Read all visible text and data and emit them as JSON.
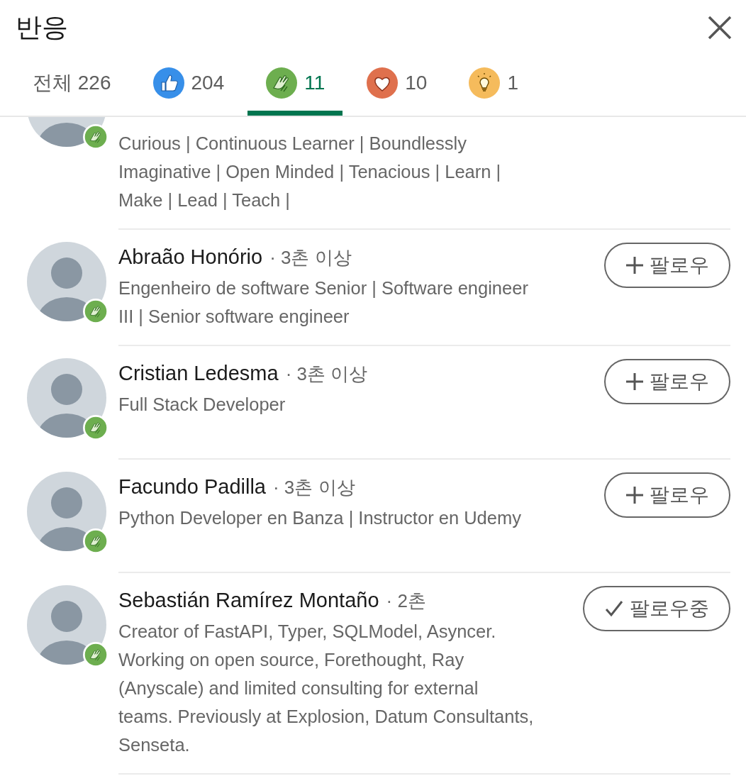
{
  "header": {
    "title": "반응"
  },
  "tabs": [
    {
      "kind": "all",
      "label": "전체 226",
      "selected": false
    },
    {
      "kind": "like",
      "label": "204",
      "selected": false
    },
    {
      "kind": "celebrate",
      "label": "11",
      "selected": true
    },
    {
      "kind": "love",
      "label": "10",
      "selected": false
    },
    {
      "kind": "insightful",
      "label": "1",
      "selected": false
    }
  ],
  "people": [
    {
      "description": "Curious | Continuous Learner | Boundlessly Imaginative | Open Minded | Tenacious | Learn | Make | Lead | Teach |"
    },
    {
      "name": "Abraão Honório",
      "degree": "· 3촌 이상",
      "description": "Engenheiro de software Senior | Software engineer III | Senior software engineer",
      "button": {
        "label": "팔로우",
        "following": false
      }
    },
    {
      "name": "Cristian Ledesma",
      "degree": "· 3촌 이상",
      "description": "Full Stack Developer",
      "button": {
        "label": "팔로우",
        "following": false
      }
    },
    {
      "name": "Facundo Padilla",
      "degree": "· 3촌 이상",
      "description": "Python Developer en Banza | Instructor en Udemy",
      "button": {
        "label": "팔로우",
        "following": false
      }
    },
    {
      "name": "Sebastián Ramírez Montaño",
      "degree": "· 2촌",
      "description": "Creator of FastAPI, Typer, SQLModel, Asyncer. Working on open source, Forethought, Ray (Anyscale) and limited consulting for external teams. Previously at Explosion, Datum Consultants, Senseta.",
      "button": {
        "label": "팔로우중",
        "following": true
      }
    }
  ]
}
